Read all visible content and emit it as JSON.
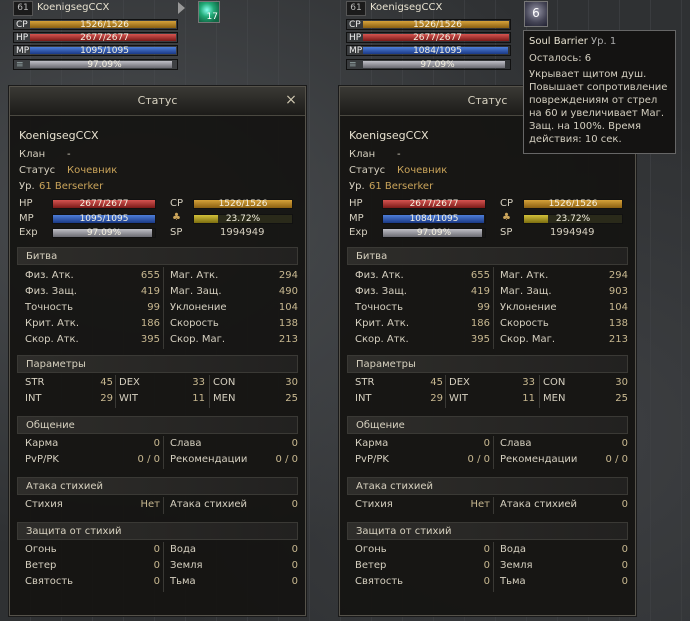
{
  "colors": {
    "cp": "#d6a23a",
    "hp": "#d65450",
    "mp": "#4e7ed8",
    "exp": "#bfbfc6",
    "sp": "#caa45a"
  },
  "panels": [
    {
      "topbar": {
        "level": "61",
        "name": "KoenigsegCCX",
        "cp": "1526/1526",
        "hp": "2677/2677",
        "mp": "1095/1095",
        "exp": "97.09%",
        "skill_count": "17"
      },
      "window": {
        "title": "Статус",
        "close": "×"
      },
      "char": {
        "name": "KoenigsegCCX",
        "clan_label": "Клан",
        "clan_value": "-",
        "status_label": "Статус",
        "status_value": "Кочевник",
        "level_label": "Ур.",
        "level_value": "61 Berserker"
      },
      "bars": {
        "hp_label": "HP",
        "hp": "2677/2677",
        "mp_label": "MP",
        "mp": "1095/1095",
        "exp_label": "Exp",
        "exp": "97.09%",
        "cp_label": "CP",
        "cp": "1526/1526",
        "weight": "23.72%",
        "sp_label": "SP",
        "sp": "1994949"
      },
      "sections": {
        "battle": "Битва",
        "params": "Параметры",
        "social": "Общение",
        "elem_atk": "Атака стихией",
        "elem_def": "Защита от стихий"
      },
      "battle": [
        {
          "l1": "Физ. Атк.",
          "v1": "655",
          "l2": "Маг. Атк.",
          "v2": "294"
        },
        {
          "l1": "Физ. Защ.",
          "v1": "419",
          "l2": "Маг. Защ.",
          "v2": "490"
        },
        {
          "l1": "Точность",
          "v1": "99",
          "l2": "Уклонение",
          "v2": "104"
        },
        {
          "l1": "Крит. Атк.",
          "v1": "186",
          "l2": "Скорость",
          "v2": "138"
        },
        {
          "l1": "Скор. Атк.",
          "v1": "395",
          "l2": "Скор. Маг.",
          "v2": "213"
        }
      ],
      "params": [
        {
          "a": "STR",
          "av": "45",
          "b": "DEX",
          "bv": "33",
          "c": "CON",
          "cv": "30"
        },
        {
          "a": "INT",
          "av": "29",
          "b": "WIT",
          "bv": "11",
          "c": "MEN",
          "cv": "25"
        }
      ],
      "social": [
        {
          "l1": "Карма",
          "v1": "0",
          "l2": "Слава",
          "v2": "0"
        },
        {
          "l1": "PvP/PK",
          "v1": "0 / 0",
          "l2": "Рекомендации",
          "v2": "0 / 0"
        }
      ],
      "elem_atk": {
        "l1": "Стихия",
        "v1": "Нет",
        "l2": "Атака стихией",
        "v2": "0"
      },
      "elem_def": [
        {
          "l1": "Огонь",
          "v1": "0",
          "l2": "Вода",
          "v2": "0"
        },
        {
          "l1": "Ветер",
          "v1": "0",
          "l2": "Земля",
          "v2": "0"
        },
        {
          "l1": "Святость",
          "v1": "0",
          "l2": "Тьма",
          "v2": "0"
        }
      ]
    },
    {
      "topbar": {
        "level": "61",
        "name": "KoenigsegCCX",
        "cp": "1526/1526",
        "hp": "2677/2677",
        "mp": "1084/1095",
        "exp": "97.09%",
        "skill_count": "6"
      },
      "window": {
        "title": "Статус",
        "close": ""
      },
      "char": {
        "name": "KoenigsegCCX",
        "clan_label": "Клан",
        "clan_value": "-",
        "status_label": "Статус",
        "status_value": "Кочевник",
        "level_label": "Ур.",
        "level_value": "61 Berserker"
      },
      "bars": {
        "hp_label": "HP",
        "hp": "2677/2677",
        "mp_label": "MP",
        "mp": "1084/1095",
        "exp_label": "Exp",
        "exp": "97.09%",
        "cp_label": "CP",
        "cp": "1526/1526",
        "weight": "23.72%",
        "sp_label": "SP",
        "sp": "1994949"
      },
      "sections": {
        "battle": "Битва",
        "params": "Параметры",
        "social": "Общение",
        "elem_atk": "Атака стихией",
        "elem_def": "Защита от стихий"
      },
      "battle": [
        {
          "l1": "Физ. Атк.",
          "v1": "655",
          "l2": "Маг. Атк.",
          "v2": "294"
        },
        {
          "l1": "Физ. Защ.",
          "v1": "419",
          "l2": "Маг. Защ.",
          "v2": "903"
        },
        {
          "l1": "Точность",
          "v1": "99",
          "l2": "Уклонение",
          "v2": "104"
        },
        {
          "l1": "Крит. Атк.",
          "v1": "186",
          "l2": "Скорость",
          "v2": "138"
        },
        {
          "l1": "Скор. Атк.",
          "v1": "395",
          "l2": "Скор. Маг.",
          "v2": "213"
        }
      ],
      "params": [
        {
          "a": "STR",
          "av": "45",
          "b": "DEX",
          "bv": "33",
          "c": "CON",
          "cv": "30"
        },
        {
          "a": "INT",
          "av": "29",
          "b": "WIT",
          "bv": "11",
          "c": "MEN",
          "cv": "25"
        }
      ],
      "social": [
        {
          "l1": "Карма",
          "v1": "0",
          "l2": "Слава",
          "v2": "0"
        },
        {
          "l1": "PvP/PK",
          "v1": "0 / 0",
          "l2": "Рекомендации",
          "v2": "0 / 0"
        }
      ],
      "elem_atk": {
        "l1": "Стихия",
        "v1": "Нет",
        "l2": "Атака стихией",
        "v2": "0"
      },
      "elem_def": [
        {
          "l1": "Огонь",
          "v1": "0",
          "l2": "Вода",
          "v2": "0"
        },
        {
          "l1": "Ветер",
          "v1": "0",
          "l2": "Земля",
          "v2": "0"
        },
        {
          "l1": "Святость",
          "v1": "0",
          "l2": "Тьма",
          "v2": "0"
        }
      ]
    }
  ],
  "tooltip": {
    "name": "Soul Barrier",
    "level": "Ур. 1",
    "remaining": "Осталось: 6",
    "description": "Укрывает щитом душ. Повышает сопротивление повреждениям от стрел на 60 и увеличивает Маг. Защ. на 100%. Время действия: 10 сек."
  }
}
